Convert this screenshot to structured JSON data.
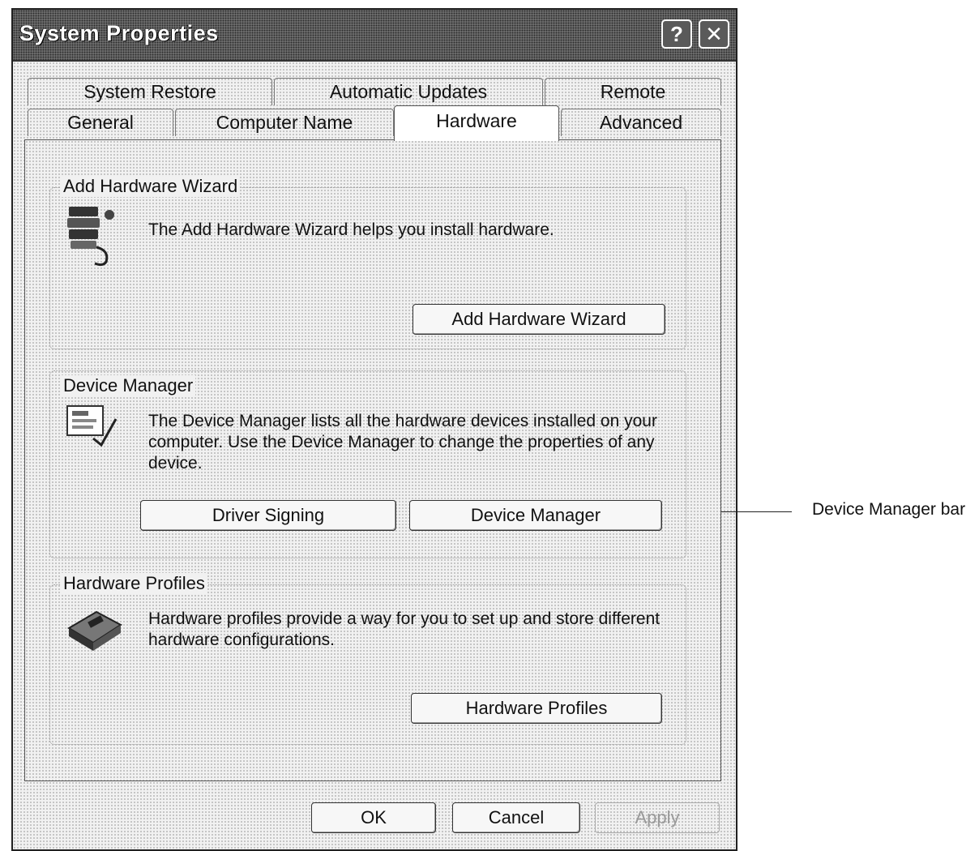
{
  "window": {
    "title": "System Properties",
    "help_glyph": "?",
    "close_glyph": "✕"
  },
  "tabs": [
    {
      "label": "System Restore",
      "active": false
    },
    {
      "label": "Automatic Updates",
      "active": false
    },
    {
      "label": "Remote",
      "active": false
    },
    {
      "label": "General",
      "active": false
    },
    {
      "label": "Computer Name",
      "active": false
    },
    {
      "label": "Hardware",
      "active": true
    },
    {
      "label": "Advanced",
      "active": false
    }
  ],
  "add_hardware": {
    "label": "Add Hardware Wizard",
    "description": "The Add Hardware Wizard helps you install hardware.",
    "button": "Add Hardware Wizard",
    "icon": "add-hardware-icon"
  },
  "device_manager": {
    "label": "Device Manager",
    "description": "The Device Manager lists all the hardware devices installed on your computer. Use the Device Manager to change the properties of any device.",
    "driver_signing_button": "Driver Signing",
    "device_manager_button": "Device Manager",
    "icon": "device-manager-icon"
  },
  "hardware_profiles": {
    "label": "Hardware Profiles",
    "description": "Hardware profiles provide a way for you to set up and store different hardware configurations.",
    "button": "Hardware Profiles",
    "icon": "hardware-profiles-icon"
  },
  "footer": {
    "ok": "OK",
    "cancel": "Cancel",
    "apply": "Apply"
  },
  "callout": {
    "label": "Device Manager bar"
  }
}
